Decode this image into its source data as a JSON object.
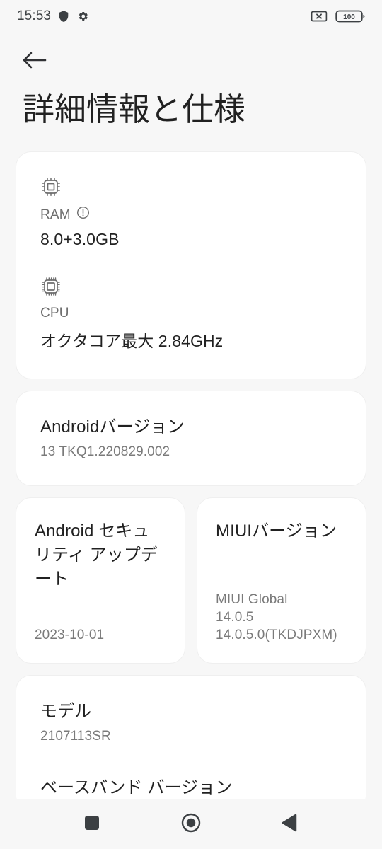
{
  "status_bar": {
    "time": "15:53",
    "icons_left": [
      "shield-icon",
      "gear-icon"
    ],
    "icons_right": [
      "no-sim-icon",
      "battery-icon"
    ],
    "battery_level": "100"
  },
  "app_bar": {
    "back_label": "back-arrow-icon",
    "title": "詳細情報と仕様"
  },
  "spec_card": {
    "ram": {
      "icon": "ram-chip-icon",
      "label": "RAM",
      "info_icon": "info-exclamation-icon",
      "value": "8.0+3.0GB"
    },
    "cpu": {
      "icon": "cpu-chip-icon",
      "label": "CPU",
      "value": "オクタコア最大 2.84GHz"
    }
  },
  "android_version_card": {
    "title": "Androidバージョン",
    "value": "13 TKQ1.220829.002"
  },
  "two_column": {
    "security_update": {
      "title": "Android セキュリティ アップデート",
      "value": "2023-10-01"
    },
    "miui_version": {
      "title": "MIUIバージョン",
      "line1": "MIUI Global",
      "line2": "14.0.5",
      "line3": "14.0.5.0(TKDJPXM)"
    }
  },
  "bottom_card": {
    "model": {
      "title": "モデル",
      "value": "2107113SR"
    },
    "baseband": {
      "title": "ベースバンド バージョン"
    }
  },
  "nav_bar": {
    "recents": "recents-square-icon",
    "home": "home-circle-icon",
    "back": "back-triangle-icon"
  },
  "colors": {
    "background": "#f7f7f7",
    "card": "#ffffff",
    "primary_text": "#212121",
    "secondary_text": "#7a7a7a",
    "icon": "#5f6368"
  }
}
